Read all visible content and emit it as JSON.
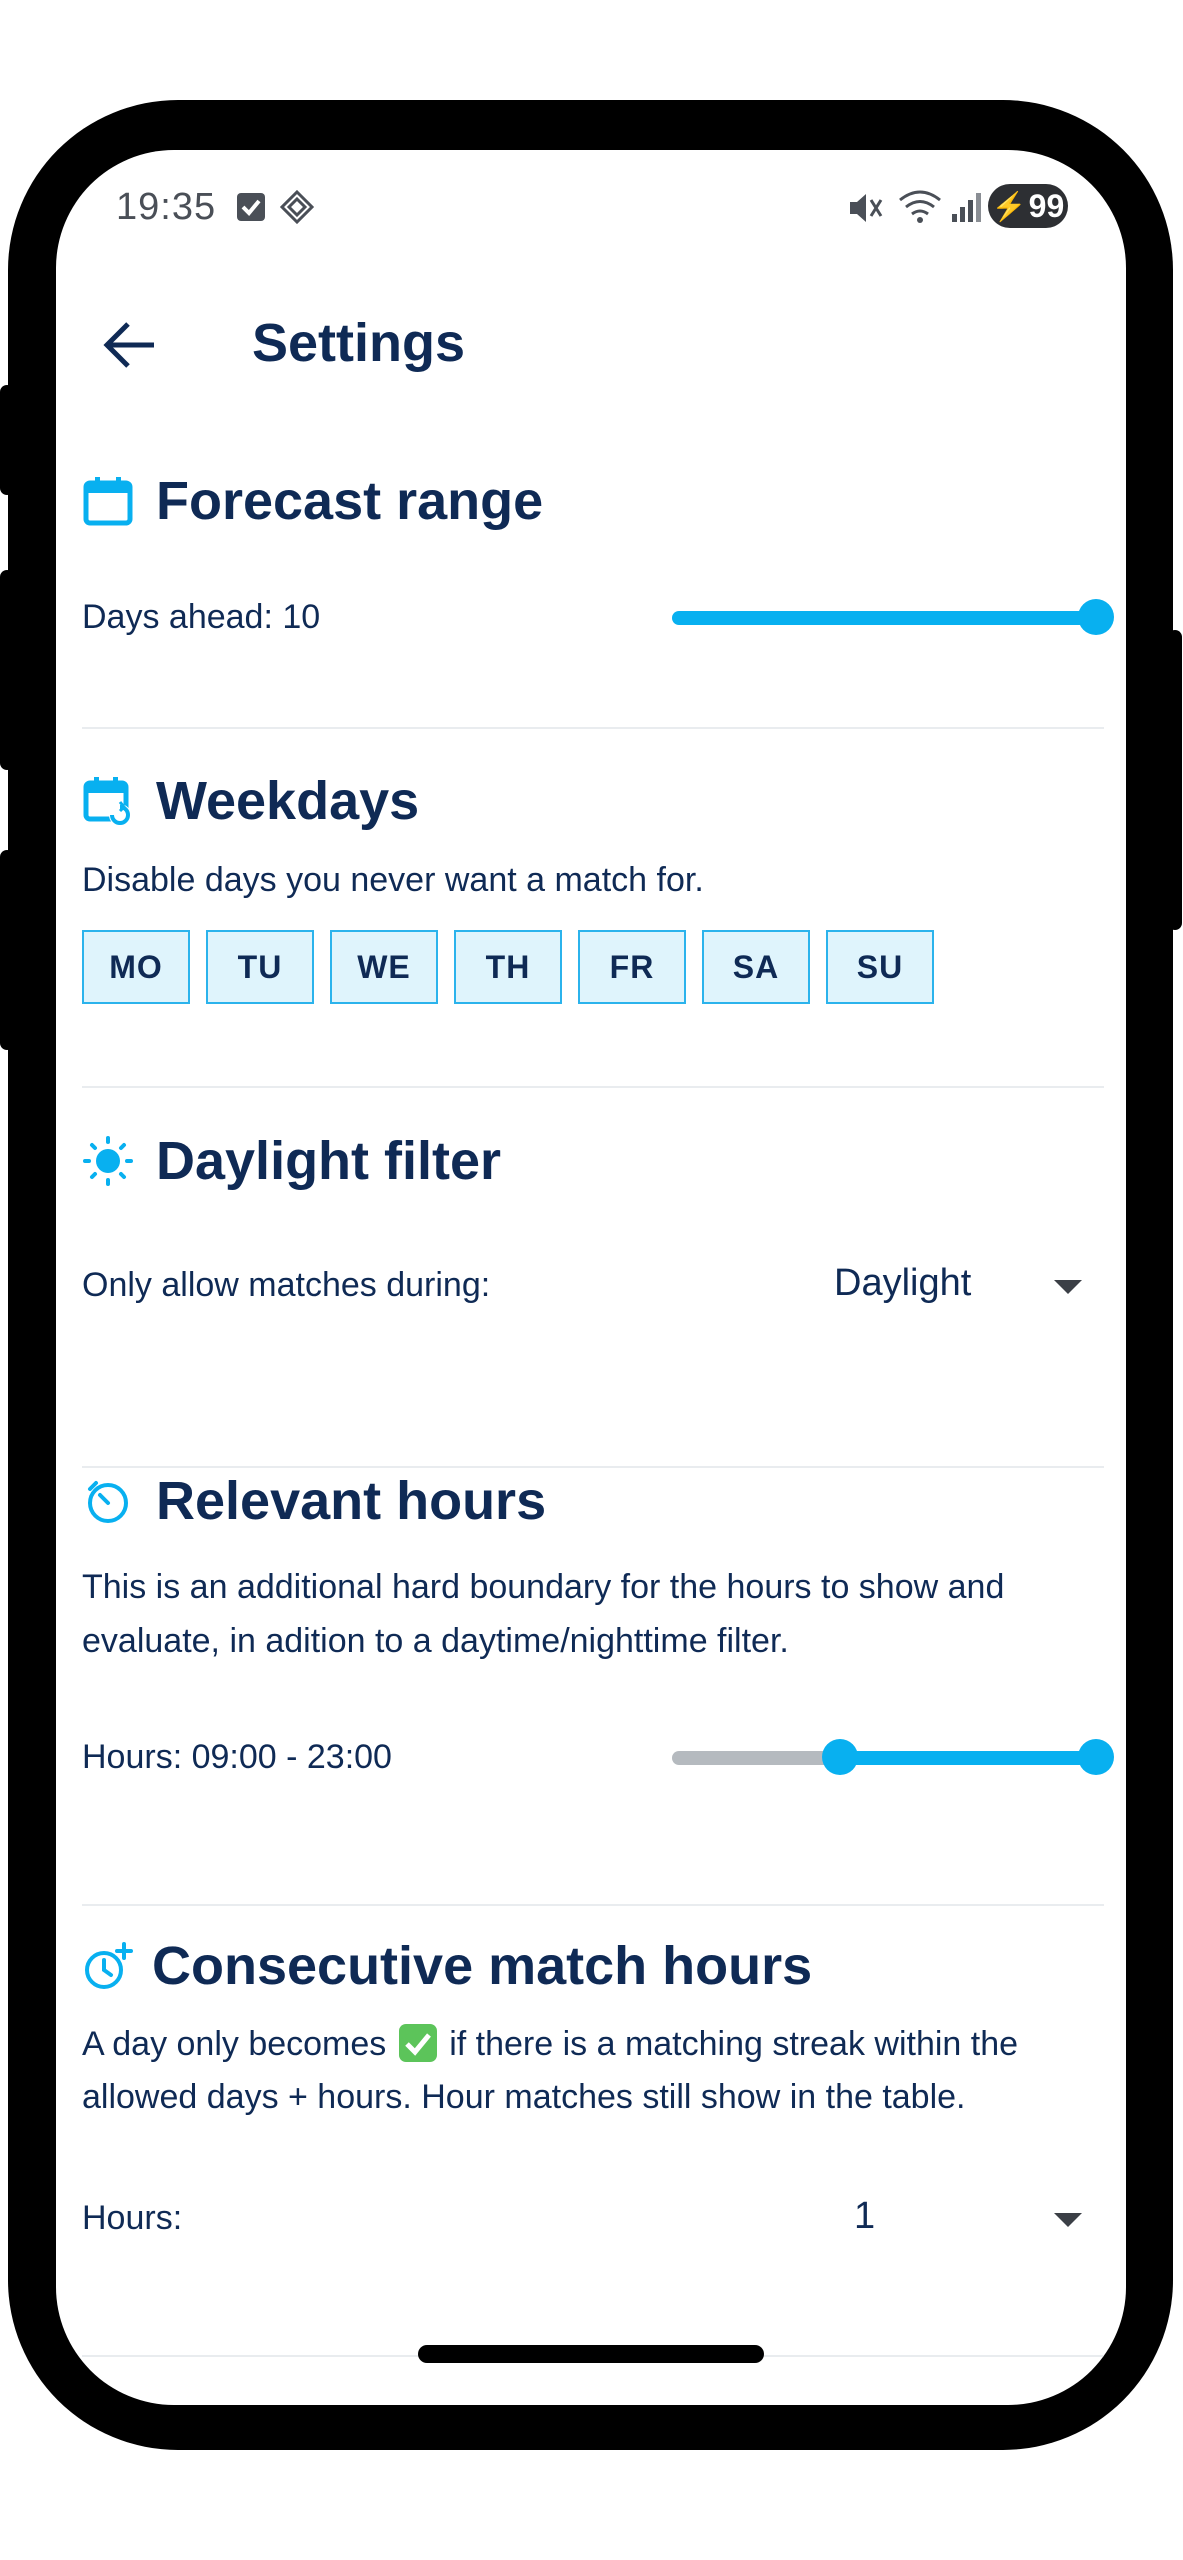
{
  "status_bar": {
    "time": "19:35",
    "battery": "99"
  },
  "header": {
    "title": "Settings"
  },
  "forecast": {
    "title": "Forecast range",
    "days_label": "Days ahead: 10",
    "days_value_fraction": 1.0
  },
  "weekdays": {
    "title": "Weekdays",
    "description": "Disable days you never want a match for.",
    "days": [
      "MO",
      "TU",
      "WE",
      "TH",
      "FR",
      "SA",
      "SU"
    ]
  },
  "daylight": {
    "title": "Daylight filter",
    "label": "Only allow matches during:",
    "value": "Daylight"
  },
  "relevant_hours": {
    "title": "Relevant hours",
    "description_line1": "This is an additional hard boundary for the hours to show and",
    "description_line2": "evaluate, in adition to a daytime/nighttime filter.",
    "hours_label": "Hours: 09:00 - 23:00",
    "range_fraction": [
      0.375,
      0.958
    ]
  },
  "consecutive": {
    "title": "Consecutive match hours",
    "description_line1_pre": "A day only becomes",
    "description_line1_post": "if there is a matching streak within the",
    "description_line2": "allowed days + hours. Hour matches still show in the table.",
    "hours_label": "Hours:",
    "value": "1"
  },
  "colors": {
    "accent": "#08b0f0",
    "text": "#0f2a55",
    "track_inactive": "#b5babf"
  }
}
